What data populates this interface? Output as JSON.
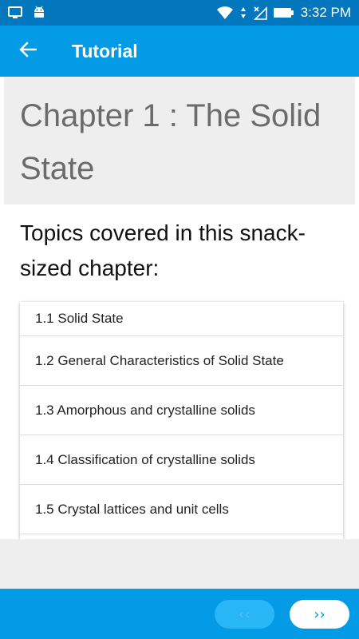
{
  "status_bar": {
    "time": "3:32 PM",
    "icons": [
      "screen-cast-icon",
      "android-icon",
      "wifi-icon",
      "data-arrows-icon",
      "no-signal-icon",
      "battery-icon"
    ]
  },
  "app_bar": {
    "title": "Tutorial",
    "back_icon": "arrow-back-icon"
  },
  "chapter": {
    "title": "Chapter 1 : The Solid State"
  },
  "topics": {
    "heading": "Topics covered in this snack-sized chapter:",
    "items": [
      "1.1 Solid State",
      "1.2 General Characteristics of Solid State",
      "1.3 Amorphous and crystalline solids",
      "1.4 Classification of crystalline solids",
      "1.5 Crystal lattices and unit cells"
    ]
  },
  "bottom_nav": {
    "prev_label": "‹‹",
    "next_label": "››"
  },
  "colors": {
    "status_bar": "#0277bd",
    "app_bar": "#039be5",
    "header_bg": "#eeeeee"
  }
}
